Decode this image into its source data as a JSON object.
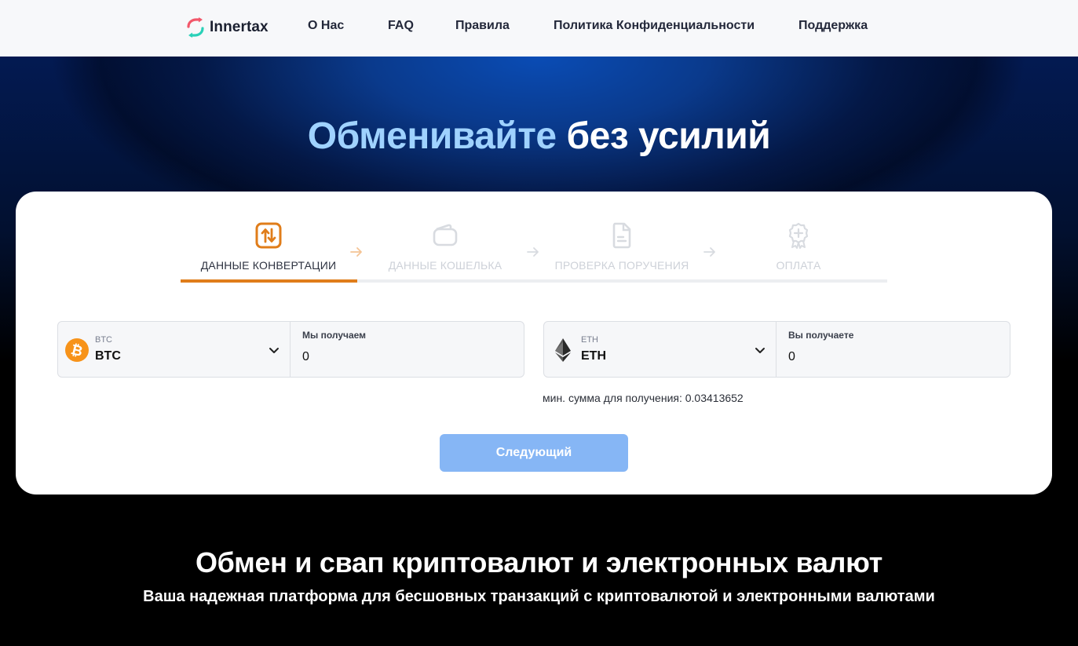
{
  "nav": {
    "brand": "Innertax",
    "links": [
      "О Нас",
      "FAQ",
      "Правила",
      "Политика Конфиденциальности",
      "Поддержка"
    ]
  },
  "hero": {
    "title_accent": "Обменивайте",
    "title_rest": "без усилий"
  },
  "steps": [
    {
      "label": "ДАННЫЕ КОНВЕРТАЦИИ",
      "icon": "swap-arrows-icon",
      "active": true
    },
    {
      "label": "ДАННЫЕ КОШЕЛЬКА",
      "icon": "wallet-icon",
      "active": false
    },
    {
      "label": "ПРОВЕРКА ПОРУЧЕНИЯ",
      "icon": "document-icon",
      "active": false
    },
    {
      "label": "ОПЛАТА",
      "icon": "award-icon",
      "active": false
    }
  ],
  "progress": {
    "current_step": 1,
    "total_steps": 4
  },
  "send": {
    "currency_small": "BTC",
    "currency": "BTC",
    "amount_label": "Мы получаем",
    "amount": "0",
    "icon": "bitcoin-icon"
  },
  "receive": {
    "currency_small": "ETH",
    "currency": "ETH",
    "amount_label": "Вы получаете",
    "amount": "0",
    "icon": "ethereum-icon"
  },
  "min_note": "мин. сумма для получения: 0.03413652",
  "next_button": "Следующий",
  "section": {
    "title": "Обмен и свап криптовалют и электронных валют",
    "subtitle": "Ваша надежная платформа для бесшовных транзакций с криптовалютой и электронными валютами"
  },
  "colors": {
    "accent_orange": "#e07d1a",
    "button_blue": "#86b6f5",
    "hero_accent": "#9fd2ff",
    "bitcoin": "#f7931a"
  }
}
